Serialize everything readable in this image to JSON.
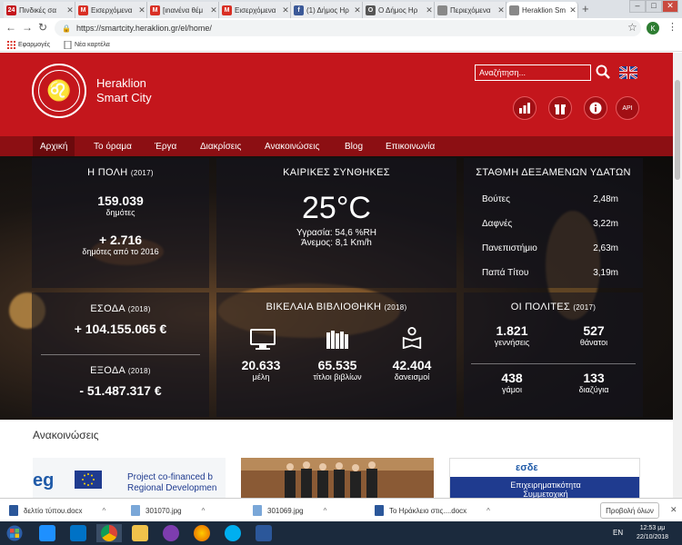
{
  "tabs": [
    {
      "title": "Πινδικές σα",
      "color": "#c4161c",
      "letter": "24"
    },
    {
      "title": "Εισερχόμενα",
      "color": "#d93025",
      "letter": "M"
    },
    {
      "title": "[ιnανένα θέμ",
      "color": "#d93025",
      "letter": "M"
    },
    {
      "title": "Εισερχόμενα",
      "color": "#d93025",
      "letter": "M"
    },
    {
      "title": "(1) Δήμος Ηρ",
      "color": "#3b5998",
      "letter": "f"
    },
    {
      "title": "Ο Δήμος Ηρ",
      "color": "#555555",
      "letter": "O"
    },
    {
      "title": "Περιεχόμενα",
      "color": "#888888",
      "letter": ""
    },
    {
      "title": "Heraklion Sm",
      "color": "#888888",
      "letter": ""
    }
  ],
  "url": "https://smartcity.heraklion.gr/el/home/",
  "avatar_letter": "K",
  "bookmarks": {
    "apps": "Εφαρμογές",
    "folder": "Νέα καρτέλα"
  },
  "brand": {
    "line1": "Heraklion",
    "line2": "Smart City"
  },
  "search": {
    "placeholder": "Αναζήτηση..."
  },
  "header_icons": [
    "chart-icon",
    "gift-icon",
    "info-icon",
    "api-icon"
  ],
  "header_icon_labels": [
    "",
    "",
    "",
    "API"
  ],
  "nav": [
    "Αρχική",
    "Το όραμα",
    "Έργα",
    "Διακρίσεις",
    "Ανακοινώσεις",
    "Blog",
    "Επικοινωνία"
  ],
  "city": {
    "title": "Η ΠΟΛΗ",
    "year": "(2017)",
    "pop": "159.039",
    "pop_label": "δημότες",
    "delta": "+ 2.716",
    "delta_label": "δημότες από το 2016"
  },
  "weather": {
    "title": "ΚΑΙΡΙΚΕΣ ΣΥΝΘΗΚΕΣ",
    "temp": "25°C",
    "humidity": "Υγρασία: 54,6 %RH",
    "wind": "Άνεμος: 8,1 Km/h"
  },
  "water": {
    "title": "ΣΤΑΘΜΗ ΔΕΞΑΜΕΝΩΝ ΥΔΑΤΩΝ",
    "rows": [
      {
        "name": "Βούτες",
        "value": "2,48m"
      },
      {
        "name": "Δαφνές",
        "value": "3,22m"
      },
      {
        "name": "Πανεπιστήμιο",
        "value": "2,63m"
      },
      {
        "name": "Παπά Τίτου",
        "value": "3,19m"
      }
    ]
  },
  "income": {
    "title": "ΕΣΟΔΑ",
    "year": "(2018)",
    "value": "+ 104.155.065 €"
  },
  "expense": {
    "title": "ΕΞΟΔΑ",
    "year": "(2018)",
    "value": "- 51.487.317 €"
  },
  "library": {
    "title": "ΒΙΚΕΛΑΙΑ ΒΙΒΛΙΟΘΗΚΗ",
    "year": "(2018)",
    "members": "20.633",
    "members_label": "μέλη",
    "titles": "65.535",
    "titles_label": "τίτλοι βιβλίων",
    "loans": "42.404",
    "loans_label": "δανεισμοί"
  },
  "citizens": {
    "title": "ΟΙ ΠΟΛΙΤΕΣ",
    "year": "(2017)",
    "births": "1.821",
    "births_label": "γεννήσεις",
    "deaths": "527",
    "deaths_label": "θάνατοι",
    "marriages": "438",
    "marriages_label": "γάμοι",
    "divorces": "133",
    "divorces_label": "διαζύγια"
  },
  "announcements_title": "Ανακοινώσεις",
  "card1": {
    "line1": "Project co-financed b",
    "line2": "Regional Developmen",
    "prefix": "eg"
  },
  "card3": {
    "brand": "εσδε",
    "line1": "Επιχειρηματικότητα",
    "line2": "Συμμετοχική"
  },
  "downloads": [
    {
      "name": "δελτίο τύπου.docx",
      "color": "#2b579a"
    },
    {
      "name": "301070.jpg",
      "color": "#7aa7d8"
    },
    {
      "name": "301069.jpg",
      "color": "#7aa7d8"
    },
    {
      "name": "Το Ηράκλειο στις....docx",
      "color": "#2b579a"
    }
  ],
  "show_all": "Προβολή όλων",
  "taskbar": {
    "lang": "EN",
    "time": "12:53 μμ",
    "date": "22/10/2018"
  }
}
